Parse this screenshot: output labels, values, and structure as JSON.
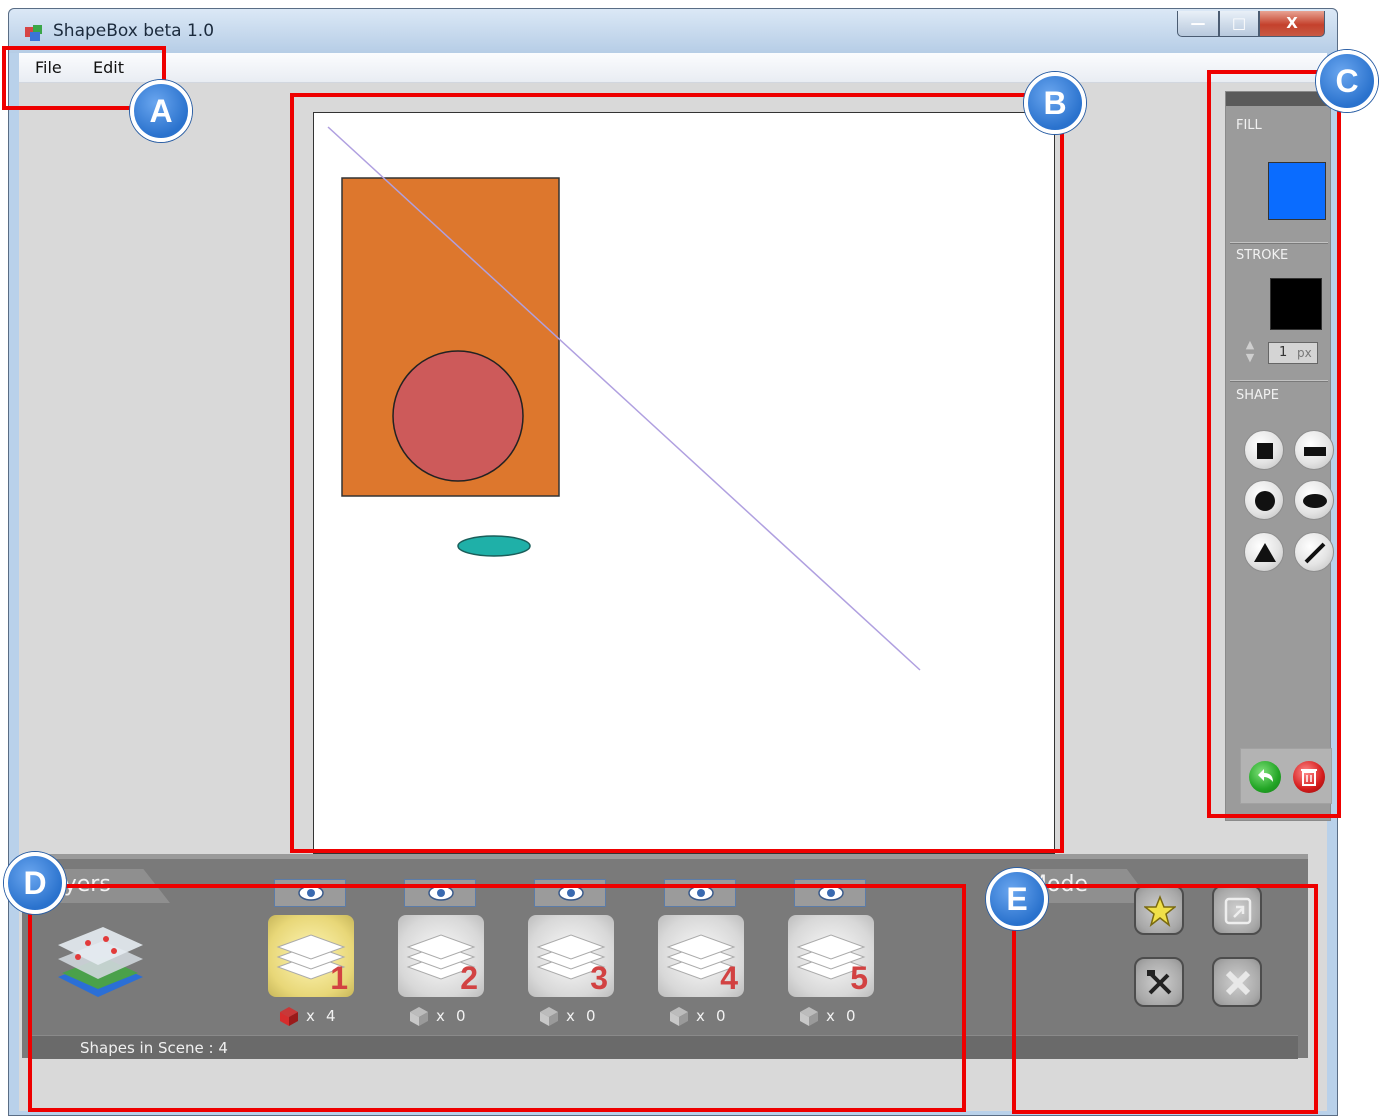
{
  "window": {
    "title": "ShapeBox beta 1.0",
    "controls": {
      "minimize": "—",
      "maximize": "□",
      "close": "X"
    }
  },
  "menu": {
    "items": [
      "File",
      "Edit"
    ]
  },
  "properties": {
    "fill_label": "FILL",
    "fill_color": "#0a6cff",
    "stroke_label": "STROKE",
    "stroke_color": "#000000",
    "stroke_width": "1",
    "stroke_unit": "px",
    "shape_label": "SHAPE",
    "shape_tools": [
      "square-icon",
      "rectangle-icon",
      "circle-icon",
      "ellipse-icon",
      "triangle-icon",
      "line-icon"
    ],
    "actions": [
      "undo-icon",
      "trash-icon"
    ]
  },
  "scene": {
    "shapes": [
      {
        "type": "rectangle",
        "fill": "#dd772d",
        "stroke": "#333333"
      },
      {
        "type": "circle",
        "fill": "#cd5a5a",
        "stroke": "#222222"
      },
      {
        "type": "ellipse",
        "fill": "#1fb0a8",
        "stroke": "#1a5e5a"
      },
      {
        "type": "line",
        "stroke": "#b0a0e0"
      }
    ]
  },
  "layers": {
    "title": "Layers",
    "items": [
      {
        "number": "1",
        "count": "4",
        "active": true
      },
      {
        "number": "2",
        "count": "0",
        "active": false
      },
      {
        "number": "3",
        "count": "0",
        "active": false
      },
      {
        "number": "4",
        "count": "0",
        "active": false
      },
      {
        "number": "5",
        "count": "0",
        "active": false
      }
    ],
    "count_prefix": "x",
    "status": "Shapes in Scene : 4"
  },
  "mode": {
    "title": "Mode",
    "buttons": [
      "star-icon",
      "export-icon",
      "tools-icon",
      "close-x-icon"
    ]
  },
  "annotations": {
    "labels": [
      "A",
      "B",
      "C",
      "D",
      "E"
    ],
    "color": "#ee0000",
    "badge_color": "#2a72cd"
  }
}
